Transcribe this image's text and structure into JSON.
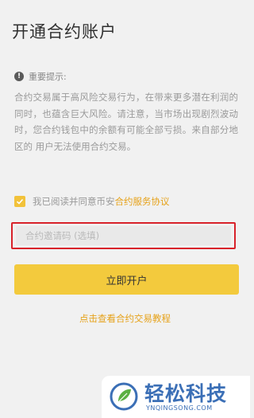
{
  "page": {
    "title": "开通合约账户"
  },
  "notice": {
    "heading": "重要提示:",
    "icon": "info-icon",
    "body": "合约交易属于高风险交易行为，在带来更多潜在利润的同时，也蕴含巨大风险。请注意，当市场出现剧烈波动时，您合约钱包中的余额有可能全部亏损。来自部分地区的 用户无法使用合约交易。"
  },
  "agreement": {
    "checked": true,
    "text": "我已阅读并同意币安",
    "link": "合约服务协议"
  },
  "invite": {
    "placeholder": "合约邀请码 (选填)",
    "value": ""
  },
  "open_button": {
    "label": "立即开户"
  },
  "tutorial": {
    "link": "点击查看合约交易教程"
  },
  "watermark": {
    "name": "轻松科技",
    "url": "YNQINGSONG.COM",
    "color": "#3b6fb6"
  },
  "colors": {
    "accent": "#f3ca3d",
    "link": "#e6a21a",
    "highlight_border": "#d8222a"
  }
}
